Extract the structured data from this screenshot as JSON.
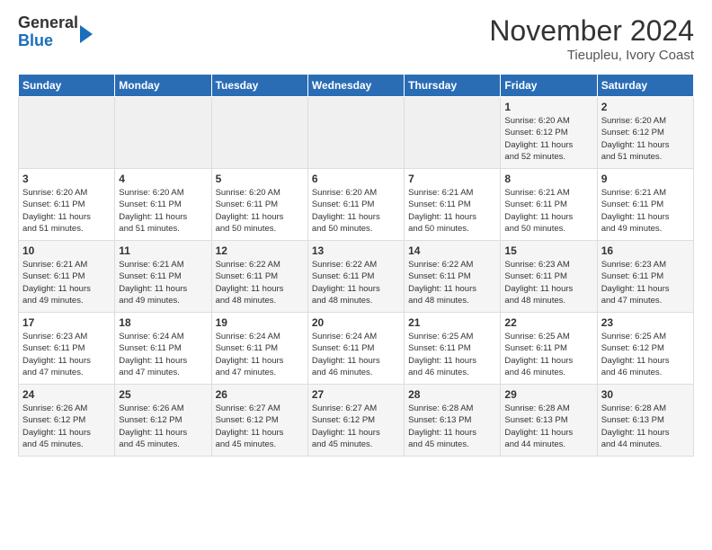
{
  "header": {
    "logo_line1": "General",
    "logo_line2": "Blue",
    "month": "November 2024",
    "location": "Tieupleu, Ivory Coast"
  },
  "weekdays": [
    "Sunday",
    "Monday",
    "Tuesday",
    "Wednesday",
    "Thursday",
    "Friday",
    "Saturday"
  ],
  "weeks": [
    [
      {
        "day": "",
        "info": ""
      },
      {
        "day": "",
        "info": ""
      },
      {
        "day": "",
        "info": ""
      },
      {
        "day": "",
        "info": ""
      },
      {
        "day": "",
        "info": ""
      },
      {
        "day": "1",
        "info": "Sunrise: 6:20 AM\nSunset: 6:12 PM\nDaylight: 11 hours\nand 52 minutes."
      },
      {
        "day": "2",
        "info": "Sunrise: 6:20 AM\nSunset: 6:12 PM\nDaylight: 11 hours\nand 51 minutes."
      }
    ],
    [
      {
        "day": "3",
        "info": "Sunrise: 6:20 AM\nSunset: 6:11 PM\nDaylight: 11 hours\nand 51 minutes."
      },
      {
        "day": "4",
        "info": "Sunrise: 6:20 AM\nSunset: 6:11 PM\nDaylight: 11 hours\nand 51 minutes."
      },
      {
        "day": "5",
        "info": "Sunrise: 6:20 AM\nSunset: 6:11 PM\nDaylight: 11 hours\nand 50 minutes."
      },
      {
        "day": "6",
        "info": "Sunrise: 6:20 AM\nSunset: 6:11 PM\nDaylight: 11 hours\nand 50 minutes."
      },
      {
        "day": "7",
        "info": "Sunrise: 6:21 AM\nSunset: 6:11 PM\nDaylight: 11 hours\nand 50 minutes."
      },
      {
        "day": "8",
        "info": "Sunrise: 6:21 AM\nSunset: 6:11 PM\nDaylight: 11 hours\nand 50 minutes."
      },
      {
        "day": "9",
        "info": "Sunrise: 6:21 AM\nSunset: 6:11 PM\nDaylight: 11 hours\nand 49 minutes."
      }
    ],
    [
      {
        "day": "10",
        "info": "Sunrise: 6:21 AM\nSunset: 6:11 PM\nDaylight: 11 hours\nand 49 minutes."
      },
      {
        "day": "11",
        "info": "Sunrise: 6:21 AM\nSunset: 6:11 PM\nDaylight: 11 hours\nand 49 minutes."
      },
      {
        "day": "12",
        "info": "Sunrise: 6:22 AM\nSunset: 6:11 PM\nDaylight: 11 hours\nand 48 minutes."
      },
      {
        "day": "13",
        "info": "Sunrise: 6:22 AM\nSunset: 6:11 PM\nDaylight: 11 hours\nand 48 minutes."
      },
      {
        "day": "14",
        "info": "Sunrise: 6:22 AM\nSunset: 6:11 PM\nDaylight: 11 hours\nand 48 minutes."
      },
      {
        "day": "15",
        "info": "Sunrise: 6:23 AM\nSunset: 6:11 PM\nDaylight: 11 hours\nand 48 minutes."
      },
      {
        "day": "16",
        "info": "Sunrise: 6:23 AM\nSunset: 6:11 PM\nDaylight: 11 hours\nand 47 minutes."
      }
    ],
    [
      {
        "day": "17",
        "info": "Sunrise: 6:23 AM\nSunset: 6:11 PM\nDaylight: 11 hours\nand 47 minutes."
      },
      {
        "day": "18",
        "info": "Sunrise: 6:24 AM\nSunset: 6:11 PM\nDaylight: 11 hours\nand 47 minutes."
      },
      {
        "day": "19",
        "info": "Sunrise: 6:24 AM\nSunset: 6:11 PM\nDaylight: 11 hours\nand 47 minutes."
      },
      {
        "day": "20",
        "info": "Sunrise: 6:24 AM\nSunset: 6:11 PM\nDaylight: 11 hours\nand 46 minutes."
      },
      {
        "day": "21",
        "info": "Sunrise: 6:25 AM\nSunset: 6:11 PM\nDaylight: 11 hours\nand 46 minutes."
      },
      {
        "day": "22",
        "info": "Sunrise: 6:25 AM\nSunset: 6:11 PM\nDaylight: 11 hours\nand 46 minutes."
      },
      {
        "day": "23",
        "info": "Sunrise: 6:25 AM\nSunset: 6:12 PM\nDaylight: 11 hours\nand 46 minutes."
      }
    ],
    [
      {
        "day": "24",
        "info": "Sunrise: 6:26 AM\nSunset: 6:12 PM\nDaylight: 11 hours\nand 45 minutes."
      },
      {
        "day": "25",
        "info": "Sunrise: 6:26 AM\nSunset: 6:12 PM\nDaylight: 11 hours\nand 45 minutes."
      },
      {
        "day": "26",
        "info": "Sunrise: 6:27 AM\nSunset: 6:12 PM\nDaylight: 11 hours\nand 45 minutes."
      },
      {
        "day": "27",
        "info": "Sunrise: 6:27 AM\nSunset: 6:12 PM\nDaylight: 11 hours\nand 45 minutes."
      },
      {
        "day": "28",
        "info": "Sunrise: 6:28 AM\nSunset: 6:13 PM\nDaylight: 11 hours\nand 45 minutes."
      },
      {
        "day": "29",
        "info": "Sunrise: 6:28 AM\nSunset: 6:13 PM\nDaylight: 11 hours\nand 44 minutes."
      },
      {
        "day": "30",
        "info": "Sunrise: 6:28 AM\nSunset: 6:13 PM\nDaylight: 11 hours\nand 44 minutes."
      }
    ]
  ]
}
